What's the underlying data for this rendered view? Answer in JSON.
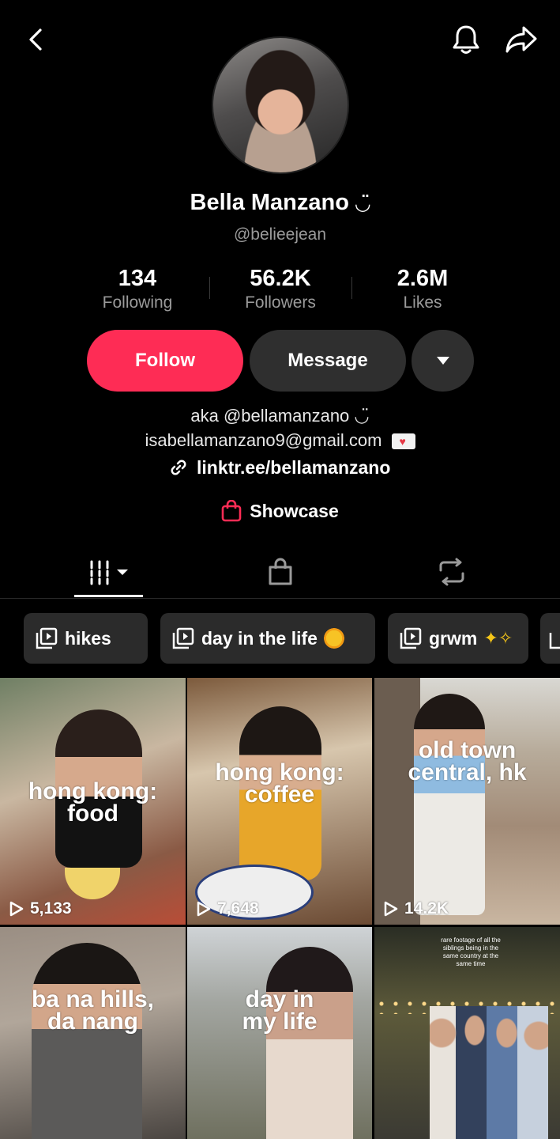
{
  "header": {
    "back_icon": "chevron-left-icon",
    "bell_icon": "bell-icon",
    "share_icon": "share-arrow-icon"
  },
  "profile": {
    "name": "Bella Manzano",
    "name_suffix": "◡̈",
    "handle": "@belieejean"
  },
  "stats": [
    {
      "value": "134",
      "label": "Following"
    },
    {
      "value": "56.2K",
      "label": "Followers"
    },
    {
      "value": "2.6M",
      "label": "Likes"
    }
  ],
  "actions": {
    "follow": "Follow",
    "message": "Message"
  },
  "bio": {
    "line1": "aka @bellamanzano ◡̈",
    "line2": "isabellamanzano9@gmail.com",
    "link": "linktr.ee/bellamanzano"
  },
  "showcase": "Showcase",
  "tabs": [
    "videos-grid",
    "shop",
    "reposts"
  ],
  "playlists": [
    {
      "label": "hikes",
      "emoji": ""
    },
    {
      "label": "day in the life",
      "emoji": "🌞"
    },
    {
      "label": "grwm",
      "emoji": "✨"
    }
  ],
  "videos": [
    {
      "caption": "hong kong: food",
      "views": "5,133"
    },
    {
      "caption": "hong kong: coffee",
      "views": "7,648"
    },
    {
      "caption": "old town central, hk",
      "views": "14.2K"
    },
    {
      "caption": "ba na hills, da nang",
      "views": ""
    },
    {
      "caption": "day in my life",
      "views": ""
    },
    {
      "caption": "rare footage of all the siblings being in the same country at the same time",
      "views": ""
    }
  ],
  "colors": {
    "accent": "#fe2c55",
    "button_dark": "#2f2f2f",
    "muted_text": "#9a9a9a"
  }
}
